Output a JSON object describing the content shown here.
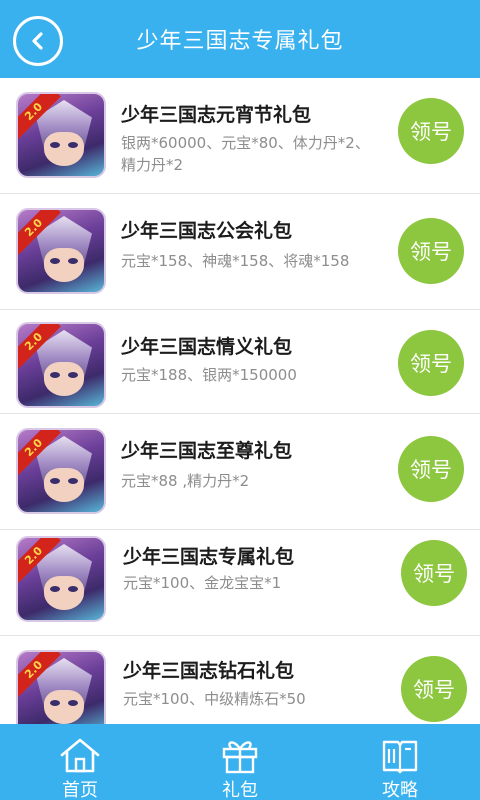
{
  "header": {
    "title": "少年三国志专属礼包",
    "back_icon": "chevron-left-icon"
  },
  "gifts": [
    {
      "name": "少年三国志元宵节礼包",
      "desc": "银两*60000、元宝*80、体力丹*2、精力丹*2",
      "badge": "2.0",
      "action": "领号"
    },
    {
      "name": "少年三国志公会礼包",
      "desc": "元宝*158、神魂*158、将魂*158",
      "badge": "2.0",
      "action": "领号"
    },
    {
      "name": "少年三国志情义礼包",
      "desc": "元宝*188、银两*150000",
      "badge": "2.0",
      "action": "领号"
    },
    {
      "name": "少年三国志至尊礼包",
      "desc": "元宝*88 ,精力丹*2",
      "badge": "2.0",
      "action": "领号"
    },
    {
      "name": "少年三国志专属礼包",
      "desc": "元宝*100、金龙宝宝*1",
      "badge": "2.0",
      "action": "领号"
    },
    {
      "name": "少年三国志钻石礼包",
      "desc": "元宝*100、中级精炼石*50",
      "badge": "2.0",
      "action": "领号"
    }
  ],
  "tabs": [
    {
      "label": "首页",
      "icon": "home-icon"
    },
    {
      "label": "礼包",
      "icon": "gift-icon"
    },
    {
      "label": "攻略",
      "icon": "book-icon"
    }
  ],
  "colors": {
    "primary": "#39b1ef",
    "button_green": "#8dc63f",
    "name_text": "#1c1c1c",
    "desc_text": "#8d8d8d"
  }
}
